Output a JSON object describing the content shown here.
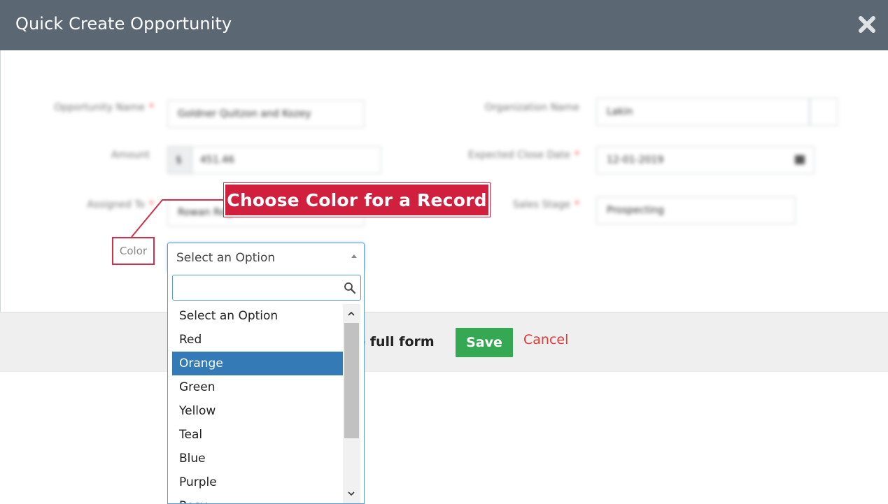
{
  "modal": {
    "title": "Quick Create Opportunity"
  },
  "form": {
    "opportunity_name": {
      "label": "Opportunity Name",
      "value": "Goldner Quitzon and Kozey"
    },
    "organization_name": {
      "label": "Organization Name",
      "value": "Lakin"
    },
    "amount": {
      "label": "Amount",
      "currency": "$",
      "value": "451.46"
    },
    "expected_close_date": {
      "label": "Expected Close Date",
      "value": "12-01-2019"
    },
    "assigned_to": {
      "label": "Assigned To",
      "value": "Rowan Rogan"
    },
    "sales_stage": {
      "label": "Sales Stage",
      "value": "Prospecting"
    },
    "required_marker": "*",
    "color": {
      "label": "Color",
      "selected": "Select an Option",
      "search_placeholder": "",
      "options": [
        "Select an Option",
        "Red",
        "Orange",
        "Green",
        "Yellow",
        "Teal",
        "Blue",
        "Purple",
        "Rosy"
      ],
      "highlighted": "Orange"
    }
  },
  "footer": {
    "full_form_link": "to full form",
    "save_label": "Save",
    "cancel_label": "Cancel"
  },
  "callout": {
    "text": "Choose Color for a Record"
  },
  "colors": {
    "header_bg": "#5b6874",
    "save_bg": "#35a853",
    "cancel": "#e53935",
    "highlight": "#337ab7",
    "callout": "#d0203e"
  }
}
